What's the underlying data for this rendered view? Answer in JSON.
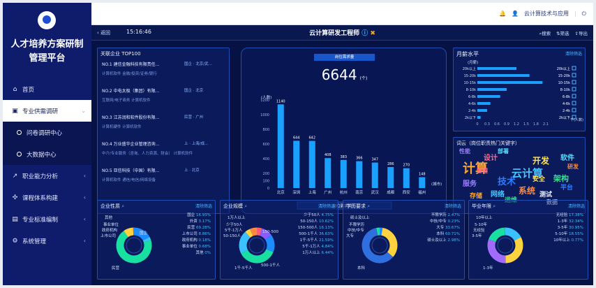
{
  "app": {
    "title": "人才培养方案研制\n管理平台"
  },
  "menu": [
    {
      "icon": "⌂",
      "label": "首页",
      "chev": ""
    },
    {
      "icon": "▣",
      "label": "专业供需调研",
      "chev": "⌄",
      "active": true
    },
    {
      "icon": "",
      "label": "问卷调研中心",
      "sub": true
    },
    {
      "icon": "",
      "label": "大数据中心",
      "sub": true
    },
    {
      "icon": "↗",
      "label": "职业能力分析",
      "chev": "‹"
    },
    {
      "icon": "✣",
      "label": "课程体系构建",
      "chev": "‹"
    },
    {
      "icon": "▤",
      "label": "专业标准编制",
      "chev": "‹"
    },
    {
      "icon": "⚙",
      "label": "系统管理",
      "chev": "‹"
    }
  ],
  "topbar": {
    "user": "云计算技术与应用"
  },
  "header": {
    "back": "返回",
    "time": "15:16:46",
    "title": "云计算研发工程师",
    "search": "搜索",
    "filter": "筛选",
    "export": "导出"
  },
  "top100": {
    "title": "关联企业 TOP100",
    "items": [
      {
        "name": "NO.1 建信金融科技有限责任...",
        "meta": "国企 · 北京/武...",
        "tags": "计算机软件  金融/投资/证券/银行"
      },
      {
        "name": "NO.2 中电太极（集团）有限...",
        "meta": "国企 · 北京",
        "tags": "互联网/电子商务  计算机软件"
      },
      {
        "name": "NO.3 江苏润和软件股份有限...",
        "meta": "民营 · 广州",
        "tags": "计算机硬件  计算机软件"
      },
      {
        "name": "NO.4 万业盛华企业管理咨询...",
        "meta": "上 · 上海/成...",
        "tags": "中介/专业服务（咨询、人力资源、财会）  计算机软件"
      },
      {
        "name": "NO.5 亚信科技（中国）有限...",
        "meta": "上 · 北京",
        "tags": "计算机软件  通信/电信/网络设备"
      }
    ]
  },
  "demand": {
    "label": "岗位需求量",
    "value": "6644",
    "unit": "(个)",
    "unit_axis": "(人数)",
    "city_axis": "(城市)",
    "footer": "岗位需求城市"
  },
  "chart_data": [
    {
      "type": "bar",
      "title": "岗位需求城市",
      "ylabel": "(人数)",
      "xlabel": "(城市)",
      "categories": [
        "北京",
        "深圳",
        "上海",
        "广州",
        "杭州",
        "南京",
        "武汉",
        "成都",
        "西安",
        "福州"
      ],
      "values": [
        1140,
        644,
        642,
        408,
        383,
        366,
        347,
        286,
        270,
        148
      ],
      "ylim": [
        0,
        1200
      ],
      "yticks": [
        0,
        100,
        200,
        400,
        600,
        800,
        1000,
        1200
      ]
    },
    {
      "type": "bar",
      "orientation": "horizontal",
      "title": "月薪水平",
      "ylabel": "(月薪)",
      "xlabel": "千(人数)",
      "categories": [
        "20k以上",
        "15-20k",
        "10-15k",
        "8-10k",
        "6-8k",
        "4-6k",
        "2-4k",
        "2k以下"
      ],
      "values": [
        1.2,
        1.6,
        2.0,
        0.9,
        0.7,
        0.4,
        0.3,
        0.1
      ],
      "xticks": [
        "0",
        "0.3",
        "0.6",
        "0.9",
        "1.2",
        "1.5",
        "1.8",
        "2.1"
      ]
    }
  ],
  "salary": {
    "title": "月薪水平",
    "filter": "清除筛选",
    "axis": "(月薪)",
    "xunit": "千(人数)",
    "legend": [
      "20k以上",
      "15-20k",
      "10-15k",
      "8-10k",
      "6-8k",
      "4-6k",
      "2-4k",
      "2k以下"
    ]
  },
  "wordcloud": {
    "title": "词云（岗位职责热门关键字）",
    "words": [
      "计算",
      "云计算",
      "技术",
      "设计",
      "开发",
      "架构",
      "服务",
      "系统",
      "测试",
      "软件",
      "存储",
      "网络",
      "平台",
      "管理",
      "安全",
      "运维",
      "性能",
      "研发",
      "数据",
      "部署"
    ]
  },
  "bottom": [
    {
      "title": "企业性质",
      "filter": "清除筛选",
      "legend": [
        [
          "国企",
          "16.93%"
        ],
        [
          "外资",
          "3.17%"
        ],
        [
          "民营",
          "69.28%"
        ],
        [
          "上市公司",
          "8.86%"
        ],
        [
          "政府机构",
          "0.18%"
        ],
        [
          "事业单位",
          "0.68%"
        ],
        [
          "其他",
          "0%"
        ]
      ],
      "side": [
        "其他",
        "事业单位",
        "政府机构",
        "上市公司",
        "民营",
        "国企"
      ]
    },
    {
      "title": "企业规模",
      "filter": "清除筛选",
      "legend": [
        [
          "少于50人",
          "4.75%"
        ],
        [
          "50-150人",
          "10.62%"
        ],
        [
          "150-500人",
          "16.13%"
        ],
        [
          "500-1千人",
          "36.63%"
        ],
        [
          "1千-5千人",
          "21.59%"
        ],
        [
          "5千-1万人",
          "4.84%"
        ],
        [
          "1万人以上",
          "6.44%"
        ]
      ],
      "side": [
        "1万人以上",
        "少于50人",
        "5千-1万人",
        "50-150人",
        "1千-5千人",
        "150-500",
        "500-1千人"
      ]
    },
    {
      "title": "学历要求",
      "filter": "清除筛选",
      "legend": [
        [
          "不限学历",
          "2.47%"
        ],
        [
          "中技/中专",
          "0.23%"
        ],
        [
          "大专",
          "33.67%"
        ],
        [
          "本科",
          "60.71%"
        ],
        [
          "硕士及以上",
          "2.98%"
        ]
      ],
      "side": [
        "硕士及以上",
        "不限学历",
        "中技/中专",
        "大专",
        "本科"
      ]
    },
    {
      "title": "毕业年限",
      "filter": "清除筛选",
      "legend": [
        [
          "无经验",
          "17.38%"
        ],
        [
          "1-3年",
          "32.34%"
        ],
        [
          "3-5年",
          "30.95%"
        ],
        [
          "5-10年",
          "18.55%"
        ],
        [
          "10年以上",
          "0.77%"
        ]
      ],
      "side": [
        "10年以上",
        "5-10年",
        "无经验",
        "3-5年",
        "1-3年"
      ]
    }
  ],
  "colors": {
    "sidebar": "#0f1c6b",
    "main": "#071244",
    "accent": "#2aa7ff"
  }
}
